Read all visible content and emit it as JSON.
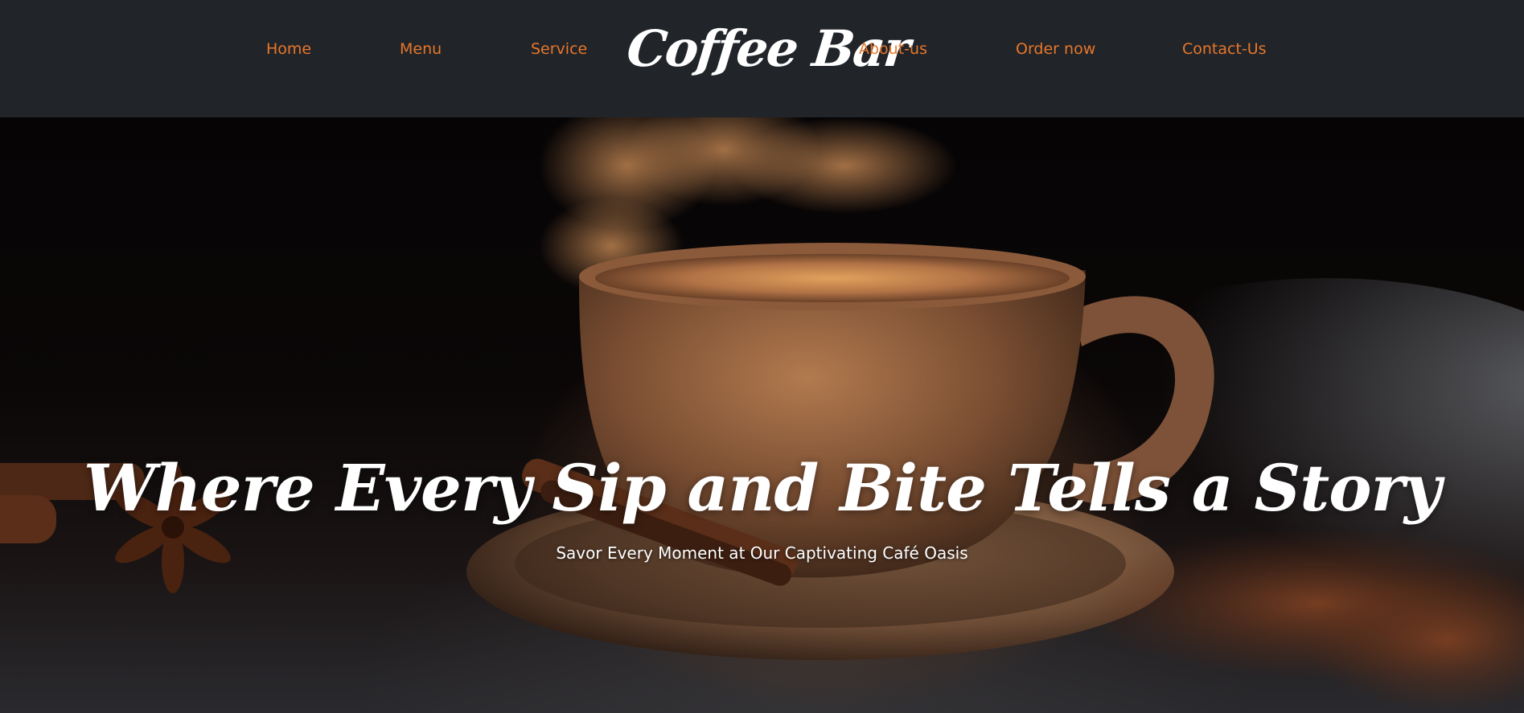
{
  "nav": {
    "home": "Home",
    "menu": "Menu",
    "service": "Service",
    "brand": "Coffee Bar",
    "about": "About-us",
    "order": "Order now",
    "contact": "Contact-Us"
  },
  "hero": {
    "title": "Where Every Sip and Bite Tells a Story",
    "subtitle": "Savor Every Moment at Our Captivating Café Oasis"
  },
  "colors": {
    "navbar_bg": "#212429",
    "nav_link": "#e8772a",
    "brand": "#ffffff",
    "hero_text": "#ffffff"
  }
}
